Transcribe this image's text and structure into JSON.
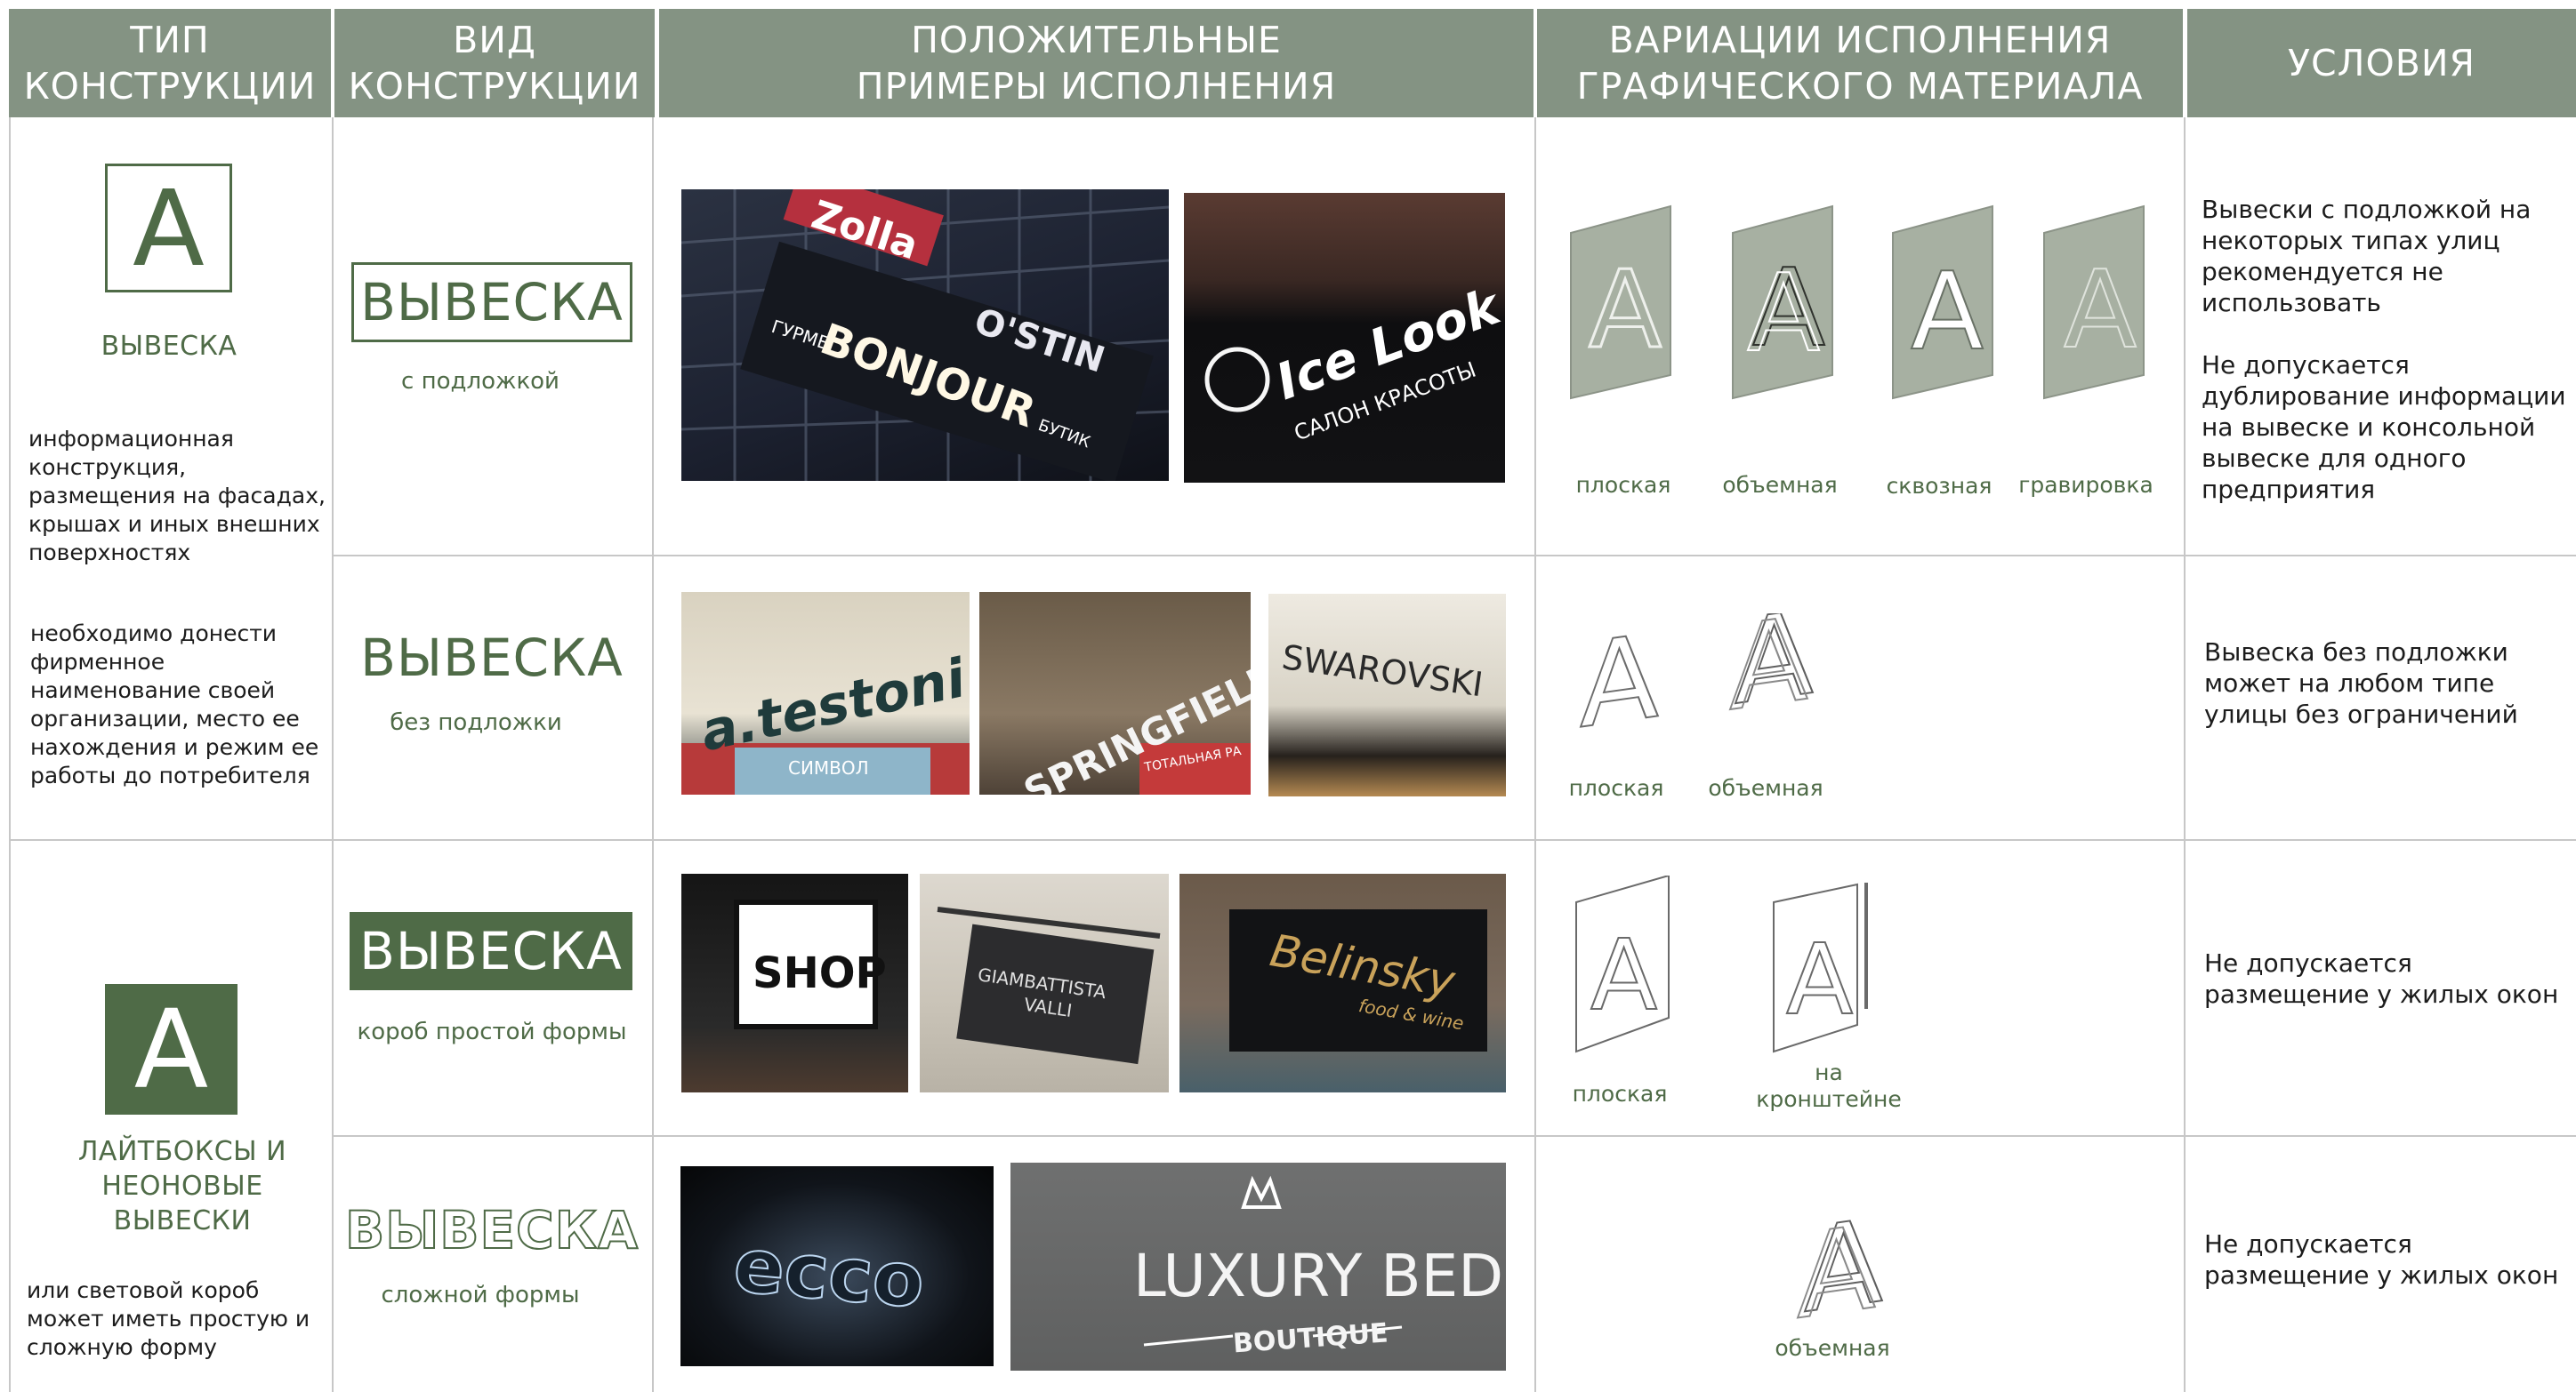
{
  "header": {
    "col_type": "ТИП\nКОНСТРУКЦИИ",
    "col_kind": "ВИД\nКОНСТРУКЦИИ",
    "col_examples": "ПОЛОЖИТЕЛЬНЫЕ\nПРИМЕРЫ ИСПОЛНЕНИЯ",
    "col_variations": "ВАРИАЦИИ ИСПОЛНЕНИЯ\nГРАФИЧЕСКОГО МАТЕРИАЛА",
    "col_conditions": "УСЛОВИЯ"
  },
  "colors": {
    "header_bg": "#849383",
    "accent": "#4f6b47",
    "variation_fill": "#a7b0a2",
    "grid": "#c7c7c7"
  },
  "groups": [
    {
      "letter": "А",
      "label": "ВЫВЕСКА",
      "desc1": "информационная конструкция, размещения на фасадах, крышах и иных внешних поверхностях",
      "desc2": "необходимо донести фирменное наименование своей организации, место ее нахождения и режим ее работы до потребителя"
    },
    {
      "letter": "А",
      "label": "ЛАЙТБОКСЫ И\nНЕОНОВЫЕ\nВЫВЕСКИ",
      "desc1": "или световой короб может иметь простую и сложную форму"
    }
  ],
  "rows": [
    {
      "sign": "ВЫВЕСКА",
      "sub": "с подложкой",
      "photos": [
        {
          "texts": [
            "Zolla",
            "O'STIN",
            "ГУРМЕ",
            "BONJOUR",
            "БУТИК"
          ],
          "icon": "facade-photo"
        },
        {
          "texts": [
            "Ice Look",
            "САЛОН КРАСОТЫ"
          ],
          "icon": "salon-photo"
        }
      ],
      "variations": [
        "плоская",
        "объемная",
        "сквозная",
        "гравировка"
      ],
      "condition1": "Вывески с подложкой на некоторых типах улиц рекомендуется не использовать",
      "condition2": "Не допускается дублирование информации на вывеске и консольной вывеске для одного предприятия"
    },
    {
      "sign": "ВЫВЕСКА",
      "sub": "без подложки",
      "photos": [
        {
          "texts": [
            "a.testoni",
            "СИМВОЛ"
          ]
        },
        {
          "texts": [
            "SPRINGFIELD",
            "ТОТАЛЬНАЯ РА"
          ]
        },
        {
          "texts": [
            "SWAROVSKI"
          ]
        }
      ],
      "variations": [
        "плоская",
        "объемная"
      ],
      "condition1": "Вывеска без подложки может на любом типе улицы без ограничений"
    },
    {
      "sign": "ВЫВЕСКА",
      "sub": "короб простой формы",
      "photos": [
        {
          "texts": [
            "SHOP"
          ]
        },
        {
          "texts": [
            "GIAMBATTISTA",
            "VALLI"
          ]
        },
        {
          "texts": [
            "Belinsky",
            "food & wine"
          ]
        }
      ],
      "variations": [
        "плоская",
        "на\nкронштейне"
      ],
      "condition1": "Не допускается размещение у жилых окон"
    },
    {
      "sign": "ВЫВЕСКА",
      "sub": "сложной формы",
      "photos": [
        {
          "texts": [
            "ecco"
          ]
        },
        {
          "texts": [
            "LUXURY BEDS",
            "BOUTIQUE"
          ]
        }
      ],
      "variations": [
        "объемная"
      ],
      "condition1": "Не допускается размещение у жилых окон"
    }
  ]
}
